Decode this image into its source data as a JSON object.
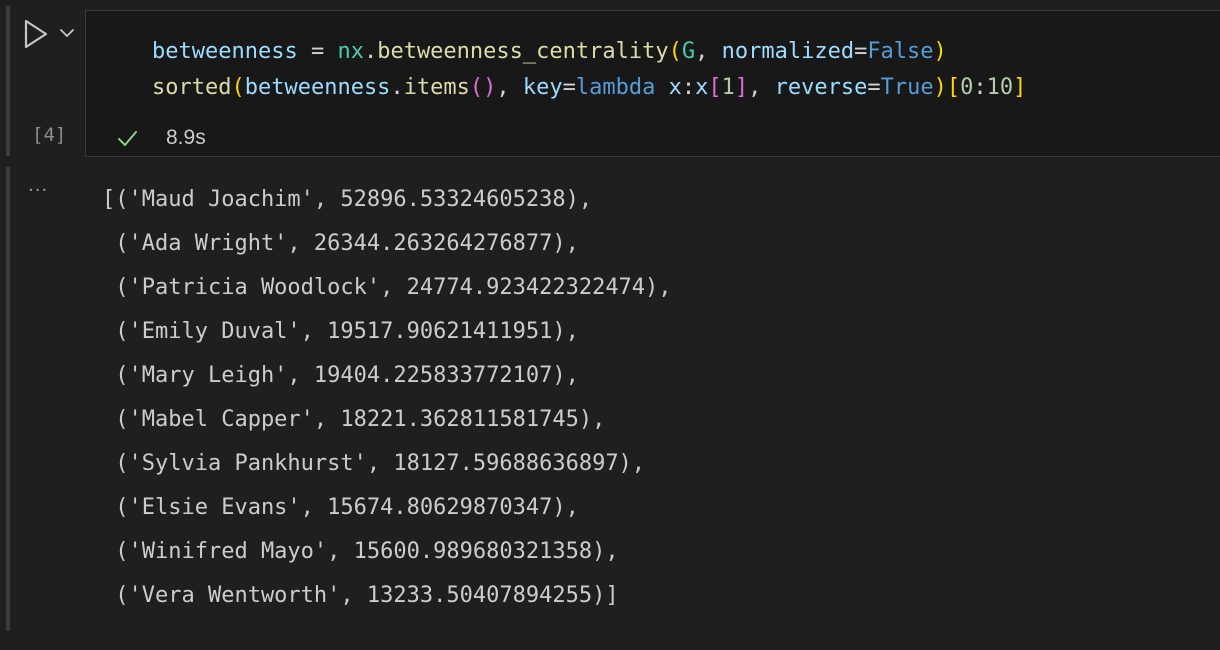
{
  "cell": {
    "execution_count": "[4]",
    "status": "succeeded",
    "duration": "8.9s",
    "output_menu": "···",
    "code": {
      "line1": {
        "var": "betweenness",
        "eq": " = ",
        "mod": "nx",
        "dot": ".",
        "fn": "betweenness_centrality",
        "open": "(",
        "arg": "G",
        "comma": ", ",
        "kwarg": "normalized",
        "kweq": "=",
        "kwval": "False",
        "close": ")"
      },
      "line2": {
        "fn_sorted": "sorted",
        "open1": "(",
        "var": "betweenness",
        "dot": ".",
        "method": "items",
        "call": "()",
        "comma1": ", ",
        "key": "key",
        "eq1": "=",
        "lambda": "lambda",
        "param": " x",
        "colon": ":",
        "x": "x",
        "sub_open": "[",
        "one": "1",
        "sub_close": "]",
        "comma2": ", ",
        "reverse": "reverse",
        "eq2": "=",
        "true": "True",
        "close1": ")",
        "slice_open": "[",
        "slice_start": "0",
        "slice_colon": ":",
        "slice_end": "10",
        "slice_close": "]"
      }
    },
    "output_lines": [
      "[('Maud Joachim', 52896.53324605238),",
      " ('Ada Wright', 26344.263264276877),",
      " ('Patricia Woodlock', 24774.923422322474),",
      " ('Emily Duval', 19517.90621411951),",
      " ('Mary Leigh', 19404.225833772107),",
      " ('Mabel Capper', 18221.362811581745),",
      " ('Sylvia Pankhurst', 18127.59688636897),",
      " ('Elsie Evans', 15674.80629870347),",
      " ('Winifred Mayo', 15600.989680321358),",
      " ('Vera Wentworth', 13233.50407894255)]"
    ]
  },
  "icons": {
    "run": "play-icon",
    "options": "chevron-down-icon",
    "status": "check-icon"
  },
  "colors": {
    "background": "#1f1f1f",
    "editor_background": "#181818",
    "success": "#89d185"
  }
}
